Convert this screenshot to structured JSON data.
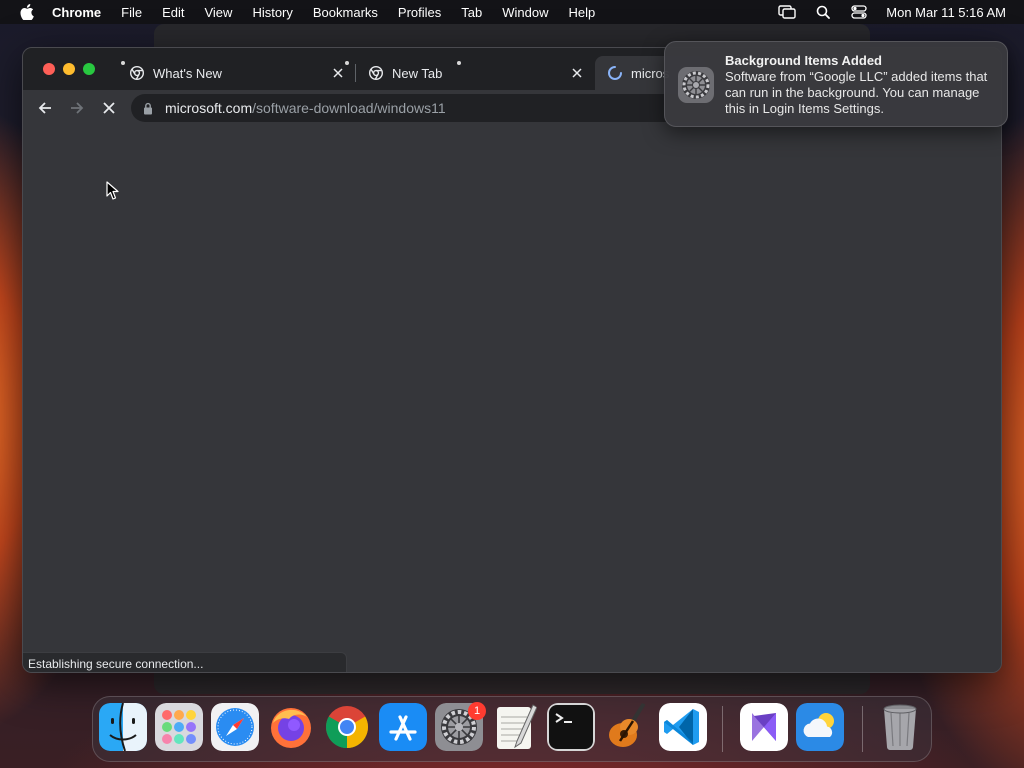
{
  "menubar": {
    "app_name": "Chrome",
    "items": [
      "File",
      "Edit",
      "View",
      "History",
      "Bookmarks",
      "Profiles",
      "Tab",
      "Window",
      "Help"
    ],
    "clock": "Mon Mar 11  5:16 AM"
  },
  "browser": {
    "tabs": [
      {
        "title": "What's New",
        "icon": "chrome-icon"
      },
      {
        "title": "New Tab",
        "icon": "chrome-icon"
      },
      {
        "title": "micros",
        "icon": "loading-spinner-icon"
      }
    ],
    "url": {
      "domain": "microsoft.com",
      "path": "/software-download/windows11"
    },
    "status": "Establishing secure connection..."
  },
  "notification": {
    "title": "Background Items Added",
    "body": "Software from “Google LLC” added items that can run in the background. You can manage this in Login Items Settings."
  },
  "dock": {
    "apps": [
      "Finder",
      "Launchpad",
      "Safari",
      "Firefox",
      "Google Chrome",
      "App Store",
      "System Settings",
      "TextEdit",
      "Terminal",
      "GarageBand",
      "Visual Studio Code",
      "Visual Studio",
      "Weather",
      "Trash"
    ],
    "badge": "1"
  },
  "colors": {
    "accent": "#8ab4f8",
    "window_bg": "#35363a",
    "tabstrip_bg": "#202124"
  }
}
